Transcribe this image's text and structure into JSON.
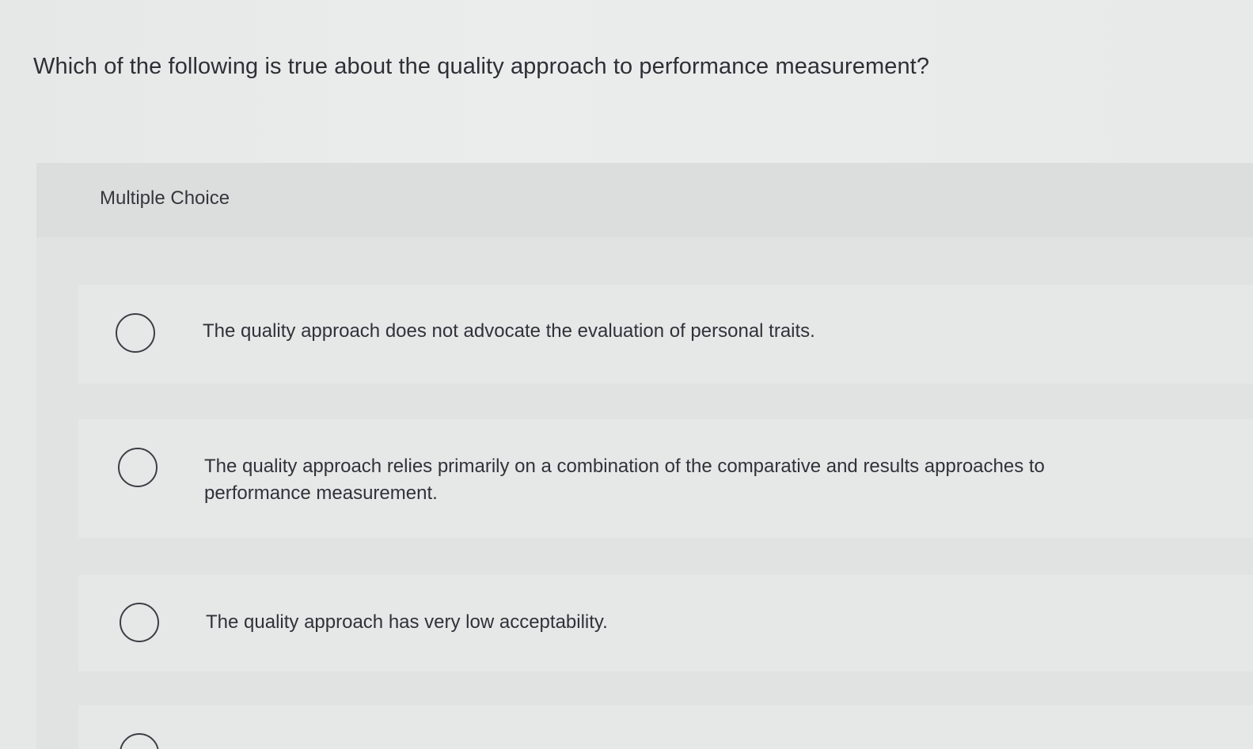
{
  "question": {
    "text": "Which of the following is true about the quality approach to performance measurement?"
  },
  "panel": {
    "label": "Multiple Choice"
  },
  "options": [
    {
      "text": "The quality approach does not advocate the evaluation of personal traits.",
      "selected": false
    },
    {
      "text": "The quality approach relies primarily on a combination of the comparative and results approaches to performance measurement.",
      "selected": false
    },
    {
      "text": "The quality approach has very low acceptability.",
      "selected": false
    },
    {
      "text": "",
      "selected": false
    }
  ]
}
